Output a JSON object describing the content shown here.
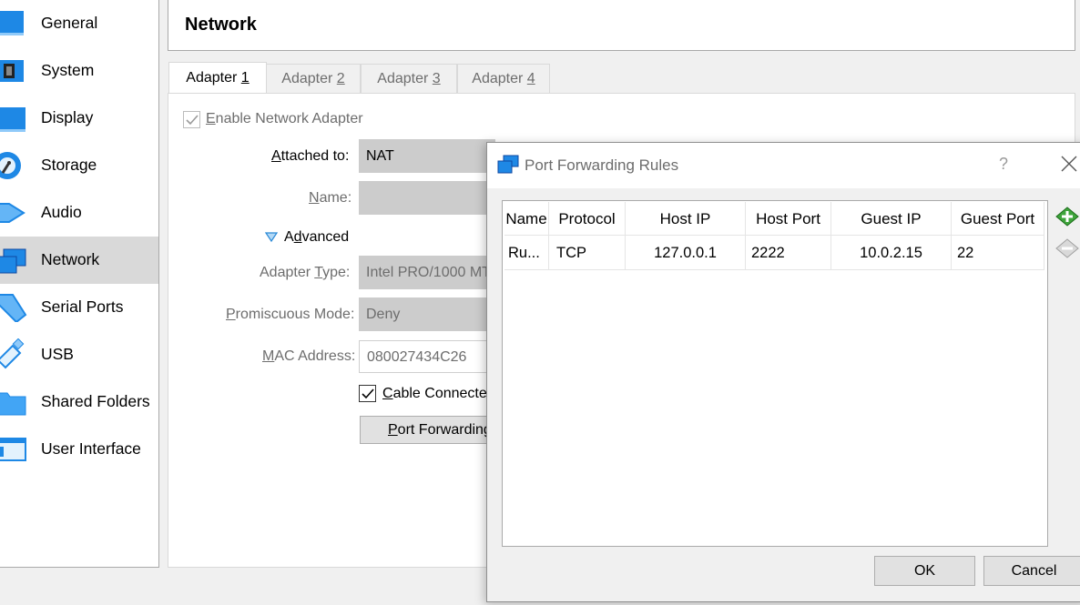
{
  "sidebar": {
    "items": [
      {
        "label": "General",
        "icon": "general-icon"
      },
      {
        "label": "System",
        "icon": "system-icon"
      },
      {
        "label": "Display",
        "icon": "display-icon"
      },
      {
        "label": "Storage",
        "icon": "storage-icon"
      },
      {
        "label": "Audio",
        "icon": "audio-icon"
      },
      {
        "label": "Network",
        "icon": "network-icon",
        "selected": true
      },
      {
        "label": "Serial Ports",
        "icon": "serial-ports-icon"
      },
      {
        "label": "USB",
        "icon": "usb-icon"
      },
      {
        "label": "Shared Folders",
        "icon": "shared-folders-icon"
      },
      {
        "label": "User Interface",
        "icon": "user-interface-icon"
      }
    ]
  },
  "page": {
    "title": "Network"
  },
  "tabs": [
    {
      "label_prefix": "Adapter ",
      "label_key": "1",
      "active": true
    },
    {
      "label_prefix": "Adapter ",
      "label_key": "2"
    },
    {
      "label_prefix": "Adapter ",
      "label_key": "3"
    },
    {
      "label_prefix": "Adapter ",
      "label_key": "4"
    }
  ],
  "adapter": {
    "enable_label_key": "E",
    "enable_label_rest": "nable Network Adapter",
    "enable_checked": true,
    "attached_label_key": "A",
    "attached_label_rest": "ttached to:",
    "attached_value": "NAT",
    "name_label_key": "N",
    "name_label_rest": "ame:",
    "name_value": "",
    "advanced_label_key": "d",
    "advanced_label_pre": "A",
    "advanced_label_rest": "vanced",
    "adapter_type_label_pre": "Adapter ",
    "adapter_type_label_key": "T",
    "adapter_type_label_rest": "ype:",
    "adapter_type_value": "Intel PRO/1000 MT",
    "promiscuous_label_key": "P",
    "promiscuous_label_rest": "romiscuous Mode:",
    "promiscuous_value": "Deny",
    "mac_label_key": "M",
    "mac_label_rest": "AC Address:",
    "mac_value": "080027434C26",
    "cable_label_key": "C",
    "cable_label_rest": "able Connected",
    "cable_checked": true,
    "port_forwarding_key": "P",
    "port_forwarding_rest": "ort Forwarding"
  },
  "dialog": {
    "title": "Port Forwarding Rules",
    "help": "?",
    "columns": [
      "Name",
      "Protocol",
      "Host IP",
      "Host Port",
      "Guest IP",
      "Guest Port"
    ],
    "rows": [
      {
        "name": "Ru...",
        "protocol": "TCP",
        "host_ip": "127.0.0.1",
        "host_port": "2222",
        "guest_ip": "10.0.2.15",
        "guest_port": "22"
      }
    ],
    "ok_label": "OK",
    "cancel_label": "Cancel"
  },
  "colors": {
    "selected_bg": "#d9d9d9",
    "disabled_text": "#6d6d6d",
    "icon_blue": "#1e88e5",
    "add_green": "#3ea43b"
  }
}
